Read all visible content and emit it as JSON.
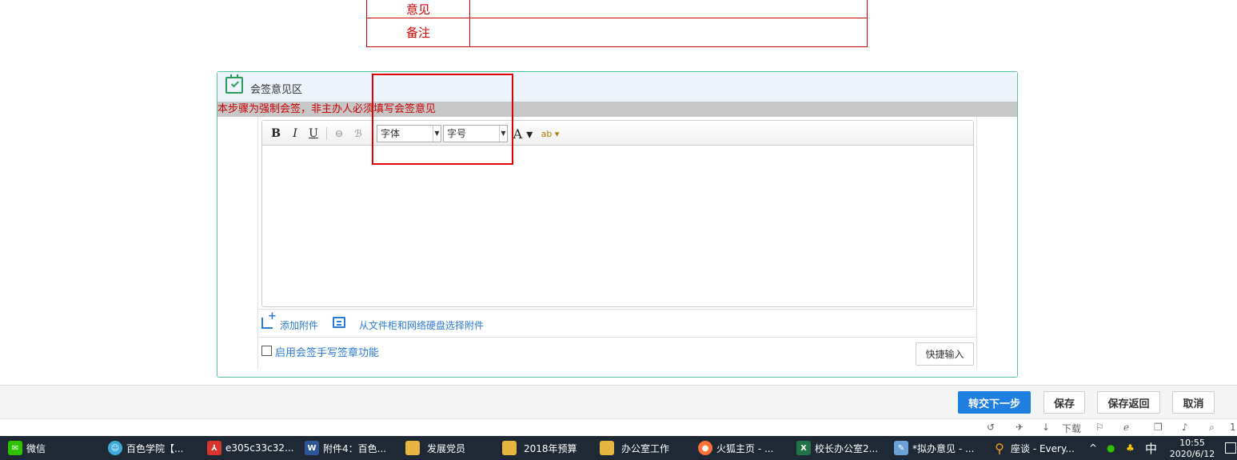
{
  "top_table": {
    "row1_label": "意见",
    "row2_label": "备注"
  },
  "panel": {
    "title": "会签意见区",
    "warning": "本步骤为强制会签，非主办人必须填写会签意见"
  },
  "editor_toolbar": {
    "bold": "B",
    "italic": "I",
    "underline": "U",
    "link_icon": "⊖",
    "unlink_icon": "ℬ",
    "font_select": "字体",
    "size_select": "字号",
    "font_color": "A ▾",
    "highlight": "ab ▾"
  },
  "attachments": {
    "add_label": "添加附件",
    "select_label": "从文件柜和网络硬盘选择附件"
  },
  "sign": {
    "label": "启用会签手写签章功能",
    "quick_input": "快捷输入"
  },
  "actions": {
    "next": "转交下一步",
    "save": "保存",
    "save_back": "保存返回",
    "cancel": "取消"
  },
  "status_strip": {
    "download": "下载",
    "zoom": "1"
  },
  "taskbar": {
    "items": [
      {
        "label": "微信",
        "icon": "wechat-icon",
        "color": "#2dc100"
      },
      {
        "label": "百色学院【...",
        "icon": "browser-icon",
        "color": "#3fa9d8"
      },
      {
        "label": "e305c33c32...",
        "icon": "pdf-icon",
        "color": "#d9342b"
      },
      {
        "label": "附件4：百色...",
        "icon": "word-icon",
        "color": "#2b579a"
      },
      {
        "label": "发展党员",
        "icon": "folder-icon",
        "color": "#e8b640"
      },
      {
        "label": "2018年预算",
        "icon": "folder-icon",
        "color": "#e8b640"
      },
      {
        "label": "办公室工作",
        "icon": "folder-icon",
        "color": "#e8b640"
      },
      {
        "label": "火狐主页 - ...",
        "icon": "firefox-icon",
        "color": "#ff7139"
      },
      {
        "label": "校长办公室2...",
        "icon": "excel-icon",
        "color": "#217346"
      },
      {
        "label": "*拟办意见 - ...",
        "icon": "notepad-icon",
        "color": "#6aa2d8"
      },
      {
        "label": "座谈 - Every...",
        "icon": "search-icon",
        "color": "#f7a11a"
      }
    ],
    "ime": "中",
    "time": "10:55",
    "date": "2020/6/12"
  }
}
